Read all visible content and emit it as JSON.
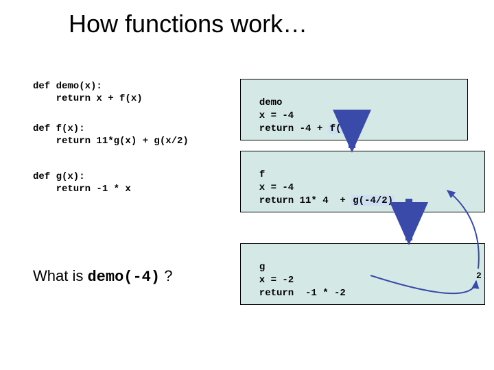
{
  "title": "How functions work…",
  "code": {
    "demo": "def demo(x):\n    return x + f(x)",
    "f": "def f(x):\n    return 11*g(x) + g(x/2)",
    "g": "def g(x):\n    return -1 * x"
  },
  "question": {
    "pre": "What is  ",
    "mono": "demo(-4)",
    "post": "  ?"
  },
  "frames": {
    "demo": {
      "header": "demo",
      "body": "  x = -4\n  return -4 + ",
      "call": "f(-4)"
    },
    "f": {
      "header": "f",
      "body": "  x = -4\n  return 11* 4 ",
      "tail": " + ",
      "call": "g(-4/2)"
    },
    "g": {
      "header": "g",
      "body": "  x = -2\n  return  -1 * -2"
    }
  },
  "results": {
    "g_return": "2"
  }
}
